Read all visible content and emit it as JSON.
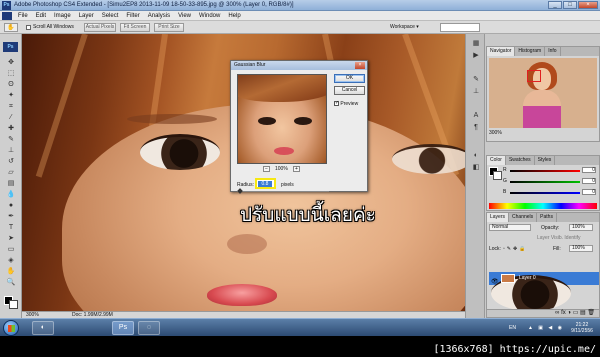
{
  "window": {
    "title": "Adobe Photoshop CS4 Extended - [Simu2EP8 2013-11-09 18-50-33-895.jpg @ 300% (Layer 0, RGB/8#)]",
    "app_icon": "Ps",
    "controls": [
      "_",
      "□",
      "×"
    ]
  },
  "menu": [
    "File",
    "Edit",
    "Image",
    "Layer",
    "Select",
    "Filter",
    "Analysis",
    "View",
    "Window",
    "Help"
  ],
  "options_bar": {
    "scroll_all_windows": "Scroll All Windows",
    "actual_pixels": "Actual Pixels",
    "fit_screen": "Fit Screen",
    "print_size": "Print Size",
    "workspace": "Workspace ▾"
  },
  "tools": {
    "logo": "Ps"
  },
  "caption": "ปรับแบบนี้เลยค่ะ",
  "status": {
    "zoom": "300%",
    "doc": "Doc: 1.99M/2.99M"
  },
  "dialog": {
    "title": "Gaussian Blur",
    "close": "×",
    "ok": "OK",
    "cancel": "Cancel",
    "preview_label": "Preview",
    "preview_checked": "✓",
    "zoom_out": "−",
    "zoom_value": "100%",
    "zoom_in": "+",
    "radius_label": "Radius:",
    "radius_value": "0.8",
    "radius_unit": "pixels",
    "slider_fraction": 0.03
  },
  "panels": {
    "navigator": {
      "tabs": [
        "Navigator",
        "Histogram",
        "Info"
      ],
      "zoom": "300%"
    },
    "color": {
      "tabs": [
        "Color",
        "Swatches",
        "Styles"
      ],
      "channels": [
        {
          "name": "R",
          "value": "0",
          "gradient": "#ff0000"
        },
        {
          "name": "G",
          "value": "0",
          "gradient": "#00c000"
        },
        {
          "name": "B",
          "value": "0",
          "gradient": "#0000ff"
        }
      ]
    },
    "layers": {
      "tabs": [
        "Layers",
        "Channels",
        "Paths"
      ],
      "blend_mode": "Normal",
      "opacity_label": "Opacity:",
      "opacity_value": "100%",
      "lock_label": "Lock:",
      "fill_label": "Fill:",
      "fill_value": "100%",
      "visibility_note": "Layer Visib. Identify",
      "layer_name": "Layer 0",
      "footer_icons": "∞ fx ◑ ▭ ▤ 🗑"
    }
  },
  "taskbar": {
    "apps": [
      "◐",
      "Ps",
      "◌"
    ],
    "lang": "EN",
    "tray_icons": "▲ ▣ ◀ ◉",
    "time": "21:22",
    "date": "9/11/2556"
  },
  "watermark": "[1366x768] https://upic.me/",
  "colors": {
    "accent_selection": "#3a7bd5",
    "radius_highlight": "#f6e812"
  }
}
